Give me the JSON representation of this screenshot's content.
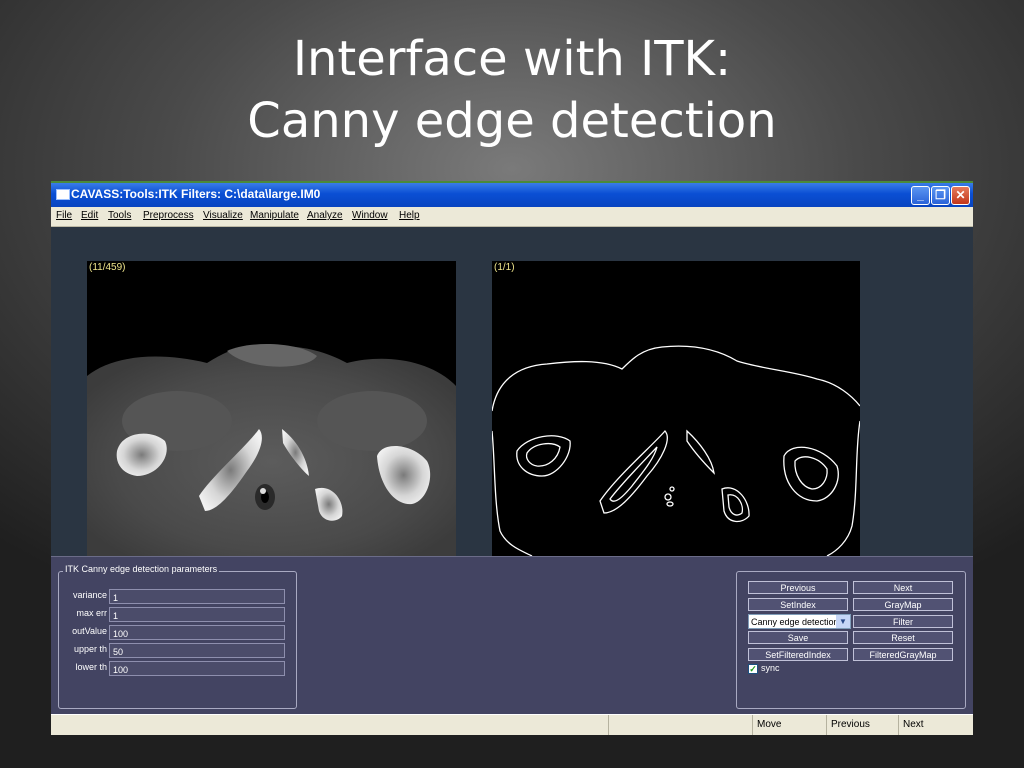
{
  "slide": {
    "title_line1": "Interface with ITK:",
    "title_line2": "Canny edge detection"
  },
  "window": {
    "title": "CAVASS:Tools:ITK Filters: C:\\data\\large.IM0",
    "controls": {
      "minimize": "_",
      "maximize": "❐",
      "close": "✕"
    }
  },
  "menu": [
    "File",
    "Edit",
    "Tools",
    "Preprocess",
    "Visualize",
    "Manipulate",
    "Analyze",
    "Window",
    "Help"
  ],
  "viewer": {
    "left_label": "(11/459)",
    "right_label": "(1/1)"
  },
  "params": {
    "legend": "ITK Canny edge detection parameters",
    "fields": [
      {
        "label": "variance",
        "value": "1"
      },
      {
        "label": "max err",
        "value": "1"
      },
      {
        "label": "outValue",
        "value": "100"
      },
      {
        "label": "upper th",
        "value": "50"
      },
      {
        "label": "lower th",
        "value": "100"
      }
    ]
  },
  "buttons": {
    "previous": "Previous",
    "next": "Next",
    "set_index": "SetIndex",
    "gray_map": "GrayMap",
    "filter_select": "Canny edge detection",
    "filter": "Filter",
    "save": "Save",
    "reset": "Reset",
    "set_filtered_index": "SetFilteredIndex",
    "filtered_gray_map": "FilteredGrayMap",
    "sync_label": "sync",
    "sync_checked": true
  },
  "status": {
    "move": "Move",
    "previous": "Previous",
    "next": "Next"
  }
}
